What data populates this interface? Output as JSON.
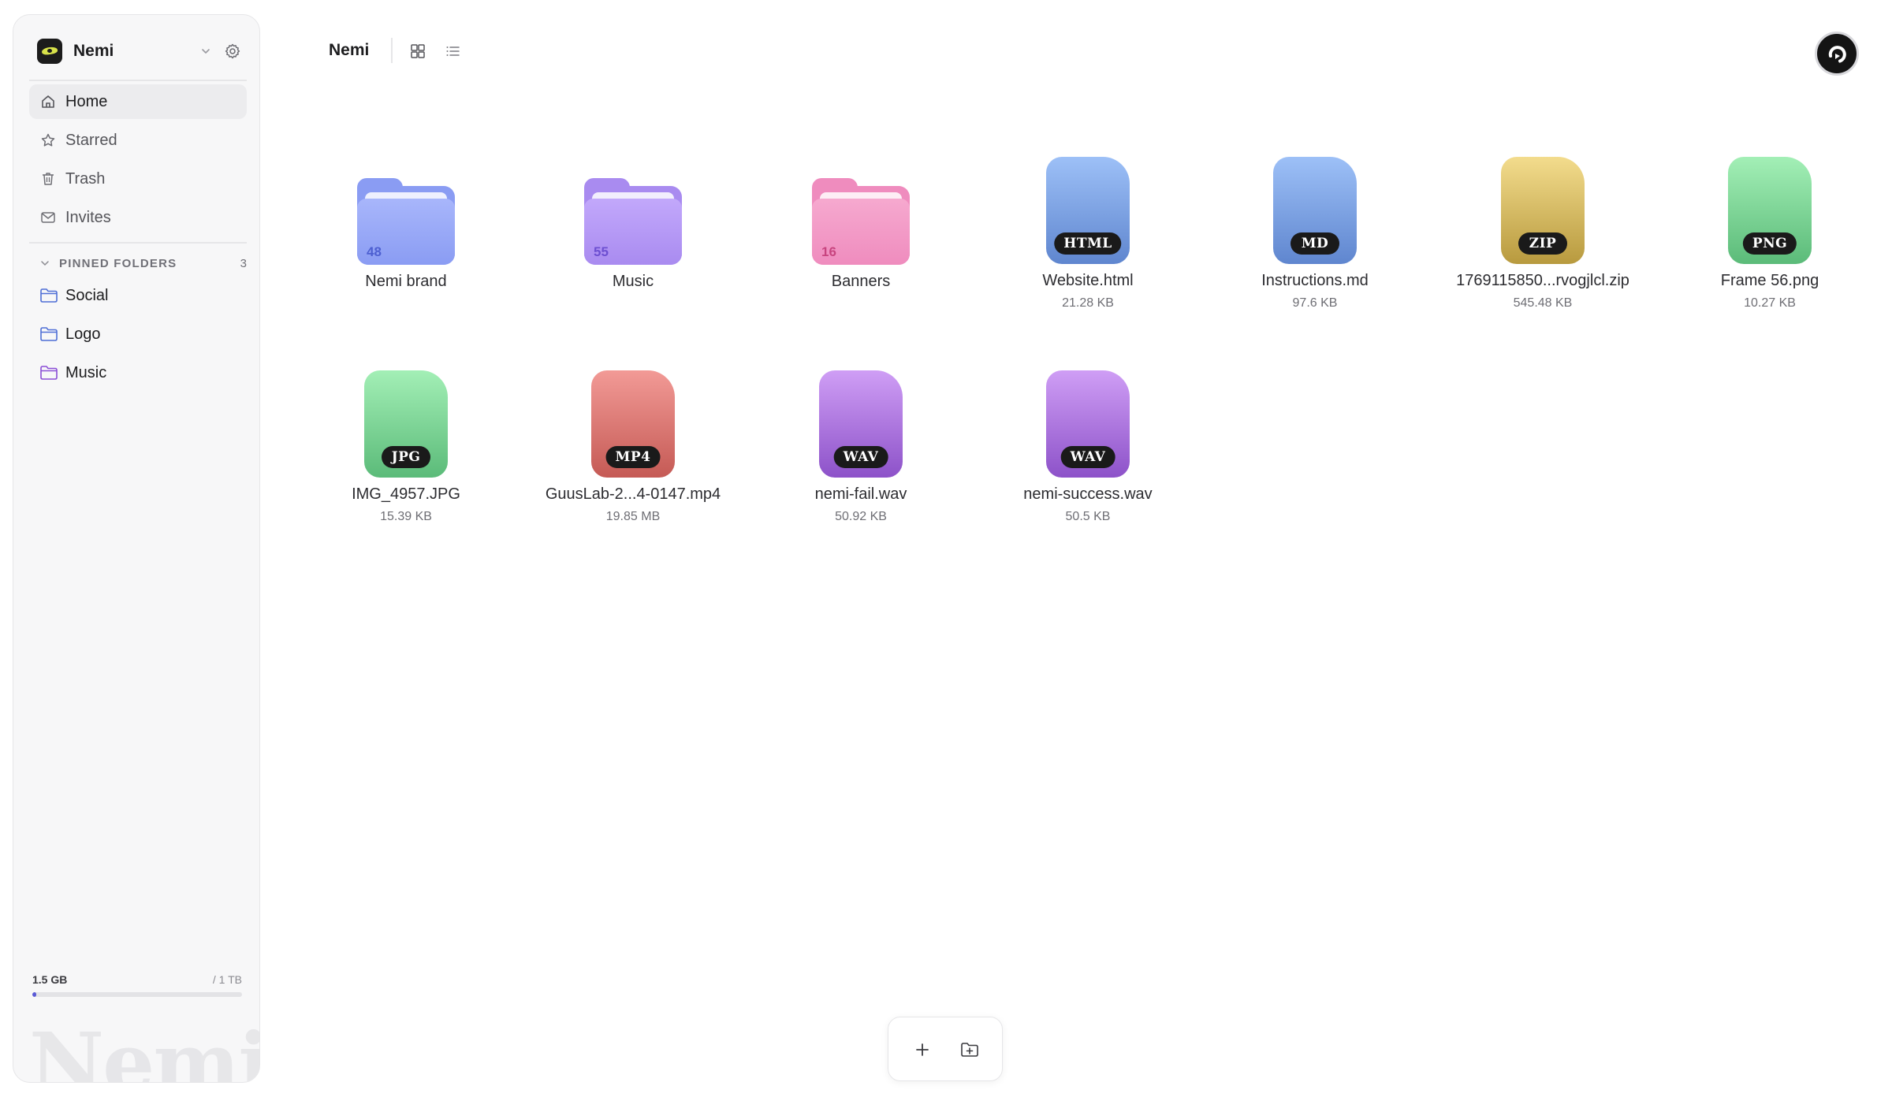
{
  "workspace": {
    "name": "Nemi"
  },
  "nav": [
    {
      "label": "Home",
      "icon": "home-icon",
      "active": true
    },
    {
      "label": "Starred",
      "icon": "star-icon",
      "active": false
    },
    {
      "label": "Trash",
      "icon": "trash-icon",
      "active": false
    },
    {
      "label": "Invites",
      "icon": "mail-icon",
      "active": false
    }
  ],
  "pinned": {
    "title": "PINNED FOLDERS",
    "count": "3",
    "items": [
      {
        "label": "Social",
        "color": "#4f6fd6"
      },
      {
        "label": "Logo",
        "color": "#4f6fd6"
      },
      {
        "label": "Music",
        "color": "#8b4fd6"
      }
    ]
  },
  "storage": {
    "used": "1.5 GB",
    "total": "/ 1 TB",
    "fraction": 0.0015
  },
  "watermark": "Nemi",
  "header": {
    "breadcrumb": "Nemi"
  },
  "folders": [
    {
      "name": "Nemi brand",
      "count": "48",
      "color": "#8a9cf3",
      "front": "#a8b6fb",
      "countColor": "#4d5fd1"
    },
    {
      "name": "Music",
      "count": "55",
      "color": "#a98bf0",
      "front": "#c2a8fb",
      "countColor": "#6d4fd1"
    },
    {
      "name": "Banners",
      "count": "16",
      "color": "#ef8cbe",
      "front": "#f6a9cf",
      "countColor": "#c8447f"
    }
  ],
  "files": [
    {
      "name": "Website.html",
      "size": "21.28 KB",
      "ext": "HTML",
      "top": "#9dc0f7",
      "bottom": "#5f86cf"
    },
    {
      "name": "Instructions.md",
      "size": "97.6 KB",
      "ext": "MD",
      "top": "#9dc0f7",
      "bottom": "#5f86cf"
    },
    {
      "name": "1769115850...rvogjlcl.zip",
      "size": "545.48 KB",
      "ext": "ZIP",
      "top": "#f3dc8d",
      "bottom": "#b89a3e"
    },
    {
      "name": "Frame 56.png",
      "size": "10.27 KB",
      "ext": "PNG",
      "top": "#a3efb6",
      "bottom": "#5bbb79"
    },
    {
      "name": "IMG_4957.JPG",
      "size": "15.39 KB",
      "ext": "JPG",
      "top": "#a3efb6",
      "bottom": "#5bbb79"
    },
    {
      "name": "GuusLab-2...4-0147.mp4",
      "size": "19.85 MB",
      "ext": "MP4",
      "top": "#f29a96",
      "bottom": "#c55a55"
    },
    {
      "name": "nemi-fail.wav",
      "size": "50.92 KB",
      "ext": "WAV",
      "top": "#cf9ef5",
      "bottom": "#8d52c9"
    },
    {
      "name": "nemi-success.wav",
      "size": "50.5 KB",
      "ext": "WAV",
      "top": "#cf9ef5",
      "bottom": "#8d52c9"
    }
  ]
}
